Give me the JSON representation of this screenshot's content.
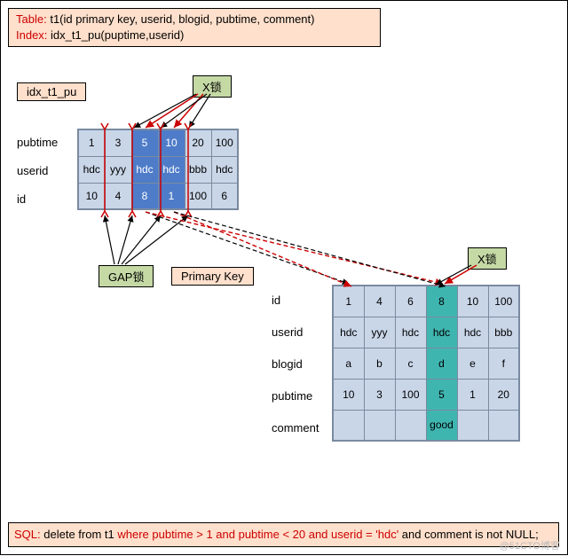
{
  "schema": {
    "tableLabel": "Table:",
    "tableDef": "t1(id primary key, userid, blogid, pubtime, comment)",
    "indexLabel": "Index:",
    "indexDef": "idx_t1_pu(puptime,userid)"
  },
  "labels": {
    "indexName": "idx_t1_pu",
    "xlockTop": "X锁",
    "xlockRight": "X锁",
    "gapLock": "GAP锁",
    "primaryKey": "Primary Key"
  },
  "indexTable": {
    "rows": [
      "pubtime",
      "userid",
      "id"
    ],
    "cols": [
      {
        "pubtime": "1",
        "userid": "hdc",
        "id": "10",
        "hl": false
      },
      {
        "pubtime": "3",
        "userid": "yyy",
        "id": "4",
        "hl": false
      },
      {
        "pubtime": "5",
        "userid": "hdc",
        "id": "8",
        "hl": true
      },
      {
        "pubtime": "10",
        "userid": "hdc",
        "id": "1",
        "hl": true
      },
      {
        "pubtime": "20",
        "userid": "bbb",
        "id": "100",
        "hl": false
      },
      {
        "pubtime": "100",
        "userid": "hdc",
        "id": "6",
        "hl": false
      }
    ]
  },
  "pkTable": {
    "rows": [
      "id",
      "userid",
      "blogid",
      "pubtime",
      "comment"
    ],
    "cols": [
      {
        "id": "1",
        "userid": "hdc",
        "blogid": "a",
        "pubtime": "10",
        "comment": "",
        "hl": false
      },
      {
        "id": "4",
        "userid": "yyy",
        "blogid": "b",
        "pubtime": "3",
        "comment": "",
        "hl": false
      },
      {
        "id": "6",
        "userid": "hdc",
        "blogid": "c",
        "pubtime": "100",
        "comment": "",
        "hl": false
      },
      {
        "id": "8",
        "userid": "hdc",
        "blogid": "d",
        "pubtime": "5",
        "comment": "good",
        "hl": true
      },
      {
        "id": "10",
        "userid": "hdc",
        "blogid": "e",
        "pubtime": "1",
        "comment": "",
        "hl": false
      },
      {
        "id": "100",
        "userid": "bbb",
        "blogid": "f",
        "pubtime": "20",
        "comment": "",
        "hl": false
      }
    ]
  },
  "sql": {
    "prefix": "SQL: ",
    "black1": "delete from t1 ",
    "red1": "where pubtime > 1 and pubtime < 20 and userid =  'hdc' ",
    "black2": "and comment is not NULL;"
  },
  "watermark": "@51CTO博客"
}
